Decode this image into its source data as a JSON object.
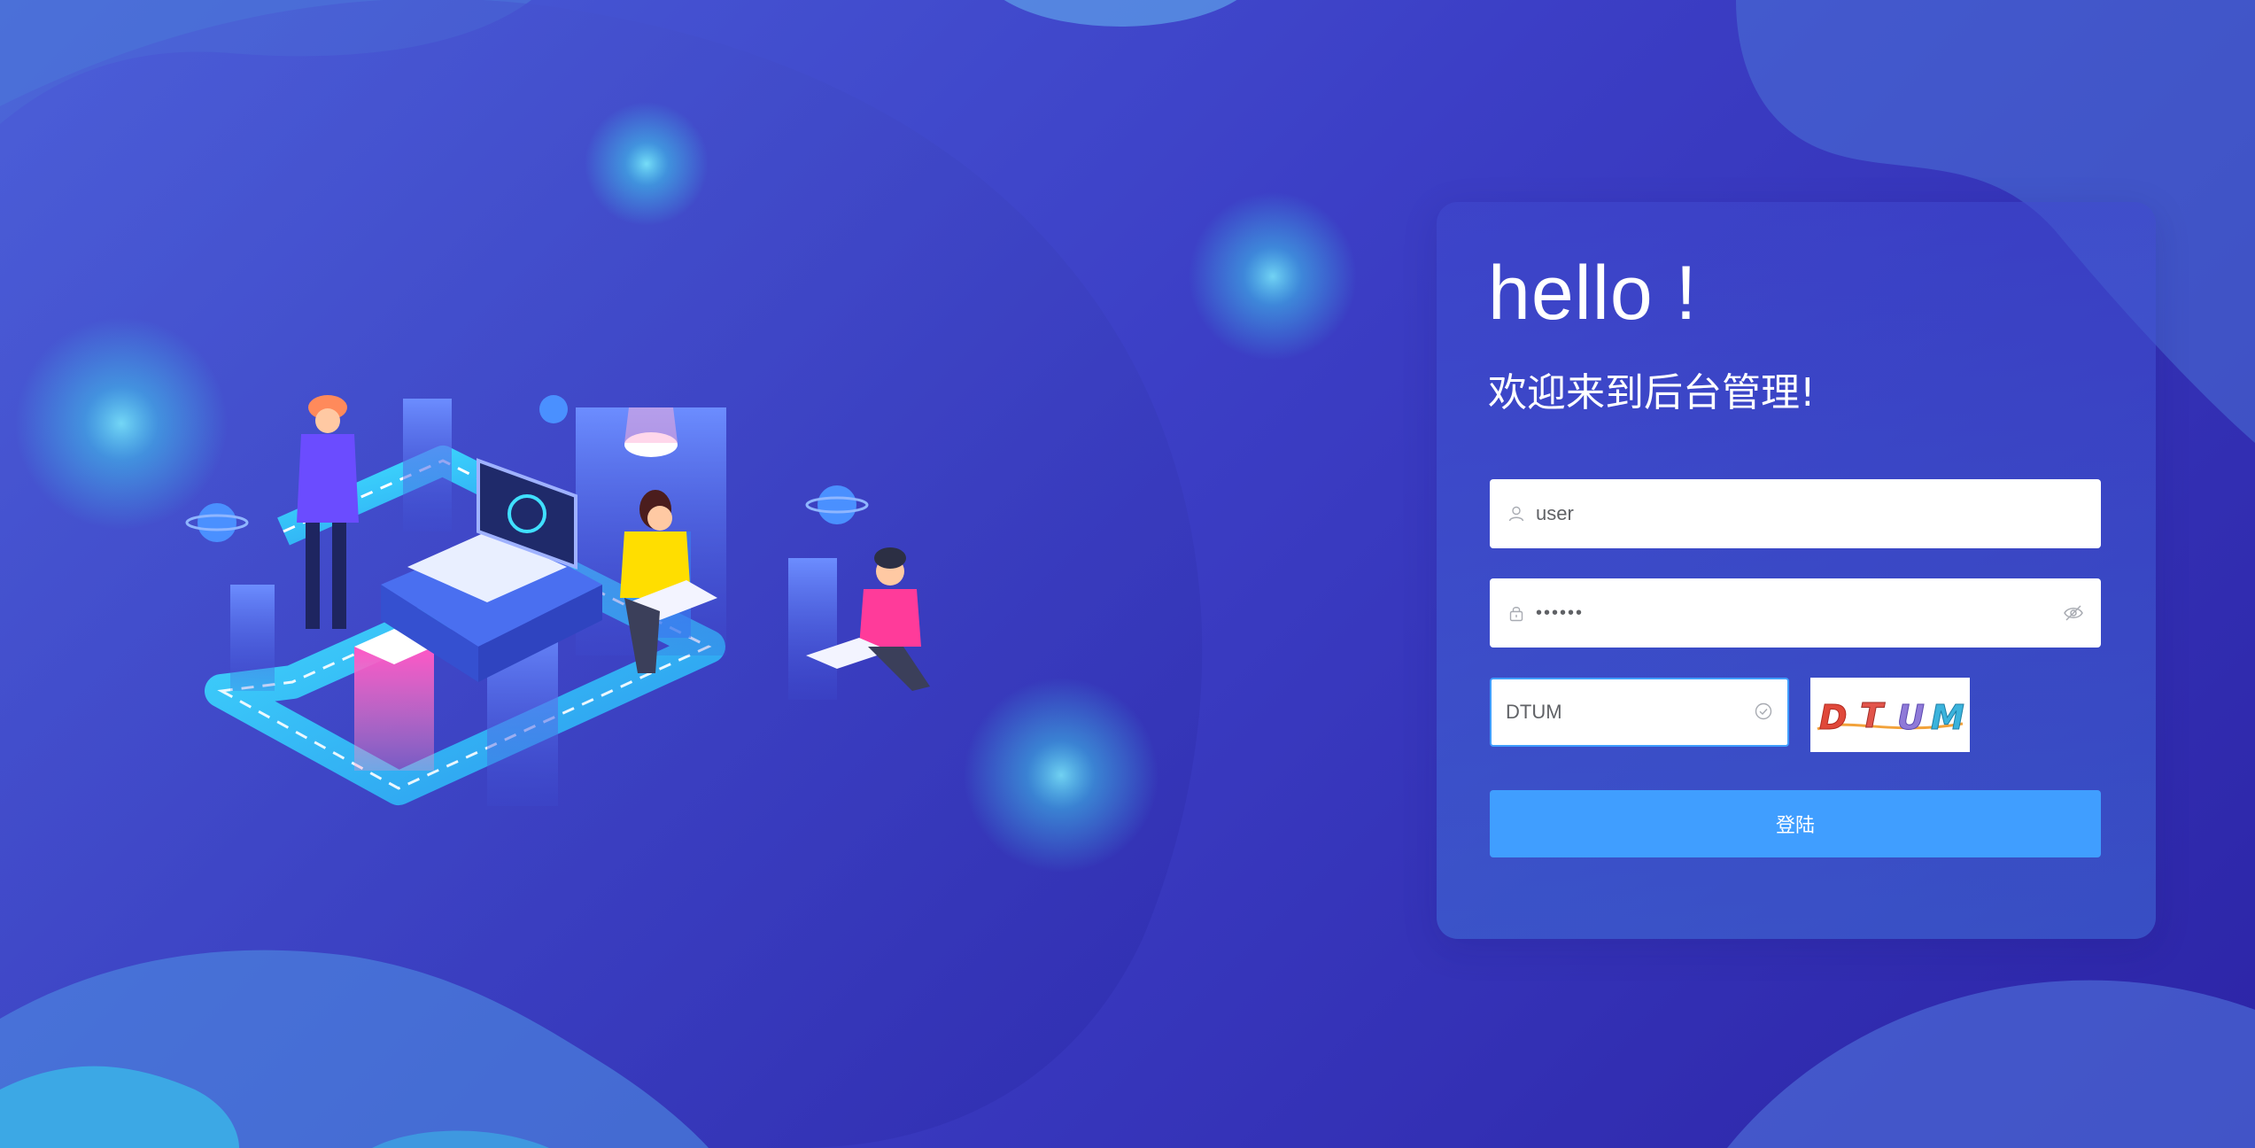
{
  "login": {
    "greeting": "hello !",
    "welcome": "欢迎来到后台管理!",
    "username_value": "user",
    "password_mask": "••••••",
    "captcha_value": "DTUM",
    "captcha_image_text": [
      "D",
      "T",
      "U",
      "M"
    ],
    "submit_label": "登陆"
  },
  "icons": {
    "user_field": "user-icon",
    "password_field": "lock-icon",
    "password_toggle": "eye-hidden-icon",
    "captcha_status": "check-circle-icon"
  },
  "colors": {
    "primary": "#409eff",
    "background_start": "#4a5fd8",
    "background_end": "#2c24a6",
    "text_light": "#ffffff",
    "input_text": "#606266"
  }
}
